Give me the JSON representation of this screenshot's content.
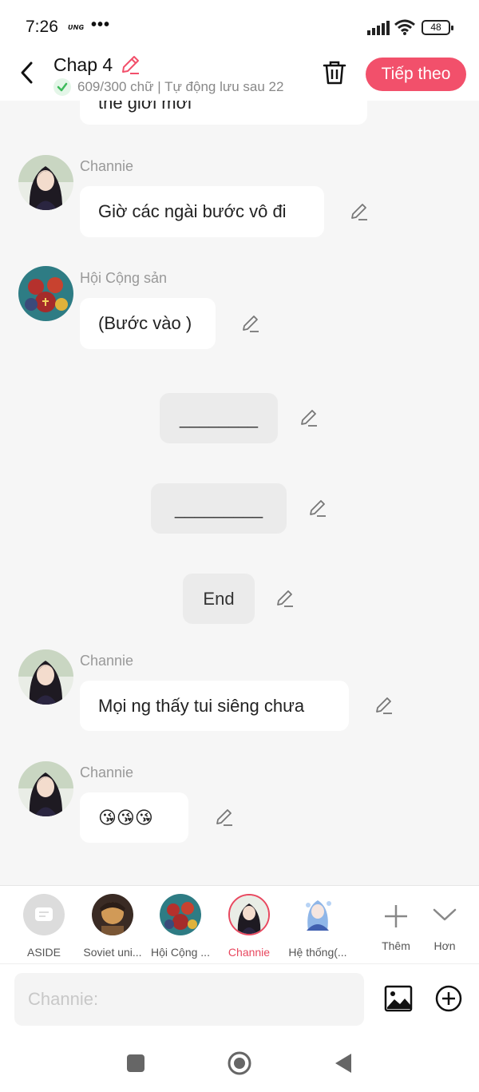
{
  "status_bar": {
    "time": "7:26",
    "carrier": "ᴜɴɢ",
    "dots": "•••",
    "battery": "48"
  },
  "header": {
    "title": "Chap 4",
    "word_count": "609/300 chữ | Tự động lưu sau 22",
    "next_label": "Tiếp theo"
  },
  "messages": [
    {
      "type": "partial",
      "text": "thế giới mới"
    },
    {
      "type": "speaker",
      "name": "Channie",
      "text": "Giờ các ngài bước vô đi"
    },
    {
      "type": "speaker",
      "name": "Hội Cộng sản",
      "text": "(Bước vào )"
    },
    {
      "type": "narration",
      "text": "________"
    },
    {
      "type": "narration",
      "text": "_________"
    },
    {
      "type": "narration",
      "text": "End"
    },
    {
      "type": "speaker",
      "name": "Channie",
      "text": "Mọi ng thấy tui siêng chưa"
    },
    {
      "type": "speaker",
      "name": "Channie",
      "text": "😘😘😘"
    }
  ],
  "characters": [
    {
      "label": "ASIDE"
    },
    {
      "label": "Soviet uni..."
    },
    {
      "label": "Hội Cộng ..."
    },
    {
      "label": "Channie",
      "active": true
    },
    {
      "label": "Hệ thống(..."
    }
  ],
  "char_actions": {
    "add_label": "Thêm",
    "more_label": "Hơn"
  },
  "input": {
    "placeholder": "Channie:"
  },
  "colors": {
    "accent": "#f2506b",
    "active_char": "#e8485f",
    "chat_bg": "#f6f6f6"
  }
}
